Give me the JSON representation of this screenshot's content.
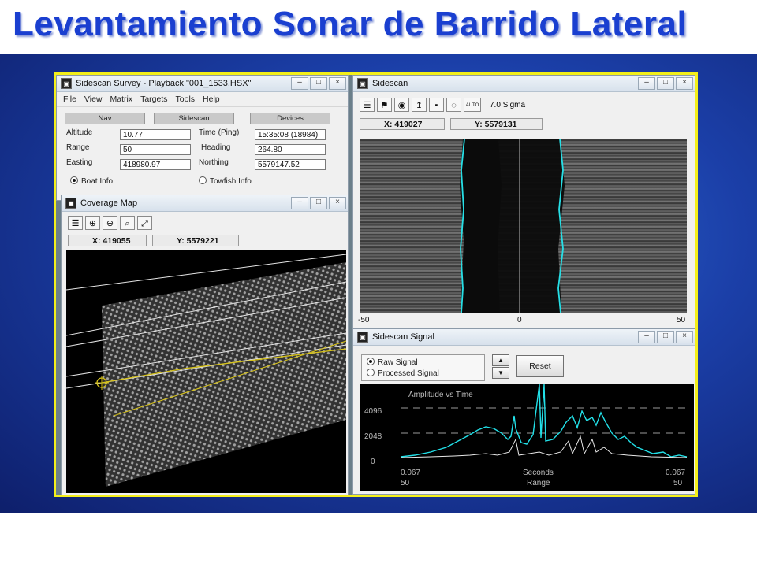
{
  "slide": {
    "title": "Levantamiento Sonar de Barrido Lateral"
  },
  "survey_window": {
    "title": "Sidescan Survey - Playback \"001_1533.HSX\"",
    "menu": [
      "File",
      "View",
      "Matrix",
      "Targets",
      "Tools",
      "Help"
    ],
    "tabs": [
      "Nav",
      "Sidescan",
      "Devices"
    ],
    "fields": [
      {
        "label": "Altitude",
        "value": "10.77"
      },
      {
        "label": "Range",
        "value": "50"
      },
      {
        "label": "Easting",
        "value": "418980.97"
      },
      {
        "label": "Time (Ping)",
        "value": "15:35:08 (18984)"
      },
      {
        "label": "Heading",
        "value": "264.80"
      },
      {
        "label": "Northing",
        "value": "5579147.52"
      }
    ],
    "radios": [
      {
        "label": "Boat Info",
        "checked": true
      },
      {
        "label": "Towfish Info",
        "checked": false
      }
    ]
  },
  "coverage_window": {
    "title": "Coverage Map",
    "x_readout": "X: 419055",
    "y_readout": "Y: 5579221",
    "icons": [
      "list-icon",
      "zoom-in-icon",
      "zoom-out-icon",
      "zoom-window-icon",
      "fit-extent-icon"
    ]
  },
  "sidescan_window": {
    "title": "Sidescan",
    "sigma": "7.0 Sigma",
    "auto_label": "AUTO",
    "x_readout": "X: 419027",
    "y_readout": "Y: 5579131",
    "axis": [
      "-50",
      "0",
      "50"
    ],
    "icons": [
      "list-icon",
      "flag-icon",
      "camera-icon",
      "upload-icon",
      "tape-icon",
      "eye-icon",
      "auto-icon"
    ]
  },
  "signal_window": {
    "title": "Sidescan Signal",
    "radios": [
      {
        "label": "Raw Signal",
        "checked": true
      },
      {
        "label": "Processed Signal",
        "checked": false
      }
    ],
    "reset_label": "Reset",
    "plot_title": "Amplitude vs Time",
    "y_ticks": [
      "4096",
      "2048",
      "0"
    ],
    "bottom_left": [
      "0.067",
      "50"
    ],
    "bottom_center": [
      "Seconds",
      "Range"
    ],
    "bottom_right": [
      "0.067",
      "50"
    ]
  },
  "colors": {
    "title": "#1a3fd0",
    "frame": "#f3ef1a",
    "track": "#d6c21a",
    "signal": "#22e0e8"
  }
}
